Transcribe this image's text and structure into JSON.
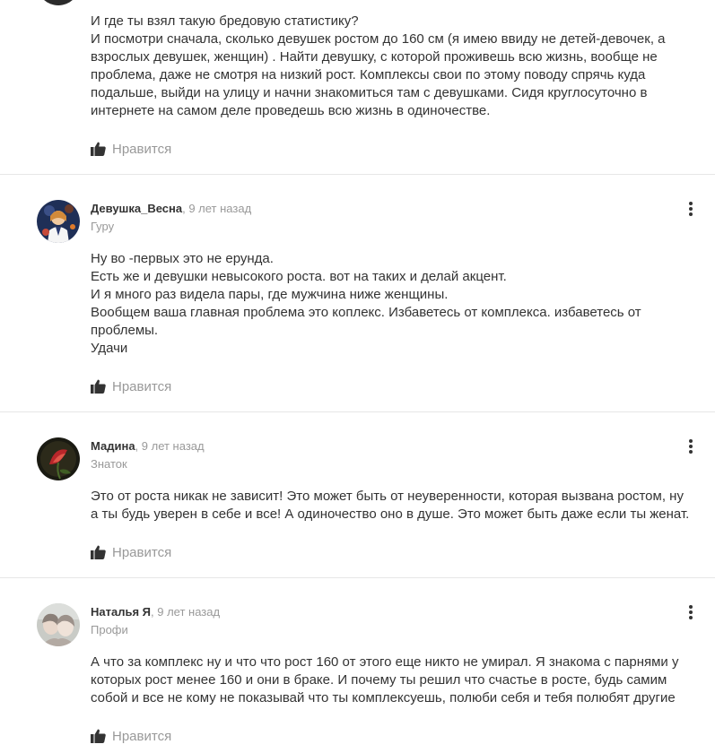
{
  "answers": [
    {
      "author": "",
      "time": "",
      "rank": "",
      "paragraphs": [
        "И где ты взял такую бредовую статистику?",
        "И посмотри сначала, сколько девушек ростом до 160 см (я имею ввиду не детей-девочек, а взрослых девушек, женщин) . Найти девушку, с которой проживешь всю жизнь, вообще не проблема, даже не смотря на низкий рост. Комплексы свои по этому поводу спрячь куда подальше, выйди на улицу и начни знакомиться там с девушками. Сидя круглосуточно в интернете на самом деле проведешь всю жизнь в одиночестве."
      ],
      "like_label": "Нравится"
    },
    {
      "author": "Девушка_Весна",
      "time": ", 9 лет назад",
      "rank": "Гуру",
      "paragraphs": [
        "Ну во -первых это не ерунда.",
        "Есть же и девушки невысокого роста. вот на таких и делай акцент.",
        "И я много раз видела пары, где мужчина ниже женщины.",
        "Вообщем ваша главная проблема это коплекс. Избаветесь от комплекса. избаветесь от проблемы.",
        "Удачи"
      ],
      "like_label": "Нравится"
    },
    {
      "author": "Мадина",
      "time": ", 9 лет назад",
      "rank": "Знаток",
      "paragraphs": [
        "Это от роста никак не зависит! Это может быть от неуверенности, которая вызвана ростом, ну а ты будь уверен в себе и все! А одиночество оно в душе. Это может быть даже если ты женат."
      ],
      "like_label": "Нравится"
    },
    {
      "author": "Наталья Я",
      "time": ", 9 лет назад",
      "rank": "Профи",
      "paragraphs": [
        "А что за комплекс ну и что что рост 160 от этого еще никто не умирал. Я знакома с парнями у которых рост менее 160 и они в браке. И почему ты решил что счастье в росте, будь самим собой и все не кому не показывай что ты комплексуешь, полюби себя и тебя полюбят другие"
      ],
      "like_label": "Нравится"
    }
  ],
  "icons": {
    "like": "thumbs-up-icon",
    "more": "more-vertical-icon"
  },
  "colors": {
    "text": "#333333",
    "muted": "#999999",
    "divider": "#e6e6e6"
  }
}
